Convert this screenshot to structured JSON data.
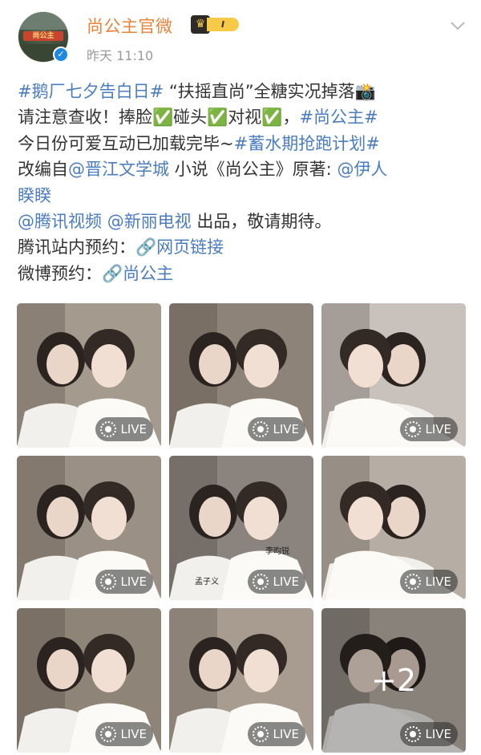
{
  "post": {
    "username": "尚公主官微",
    "timestamp": "昨天 11:10",
    "verified_icon": "verified-badge-icon",
    "level_badge": "I",
    "avatar_text": "尚公主",
    "lines": [
      [
        {
          "t": "#鹅厂七夕告白日#",
          "c": "blue"
        },
        {
          "t": " “扶摇直尚”全糖实况掉落📸",
          "c": ""
        }
      ],
      [
        {
          "t": "请注意查收！捧脸✅碰头✅对视✅，",
          "c": ""
        },
        {
          "t": "#尚公主#",
          "c": "blue"
        }
      ],
      [
        {
          "t": "今日份可爱互动已加载完毕~",
          "c": ""
        },
        {
          "t": "#蓄水期抢跑计划#",
          "c": "blue"
        }
      ],
      [
        {
          "t": "改编自",
          "c": ""
        },
        {
          "t": "@晋江文学城",
          "c": "blue"
        },
        {
          "t": " 小说《尚公主》原著: ",
          "c": ""
        },
        {
          "t": "@伊人",
          "c": "blue"
        }
      ],
      [
        {
          "t": "睽睽",
          "c": "blue"
        }
      ],
      [
        {
          "t": "@腾讯视频",
          "c": "blue"
        },
        {
          "t": " ",
          "c": ""
        },
        {
          "t": "@新丽电视",
          "c": "blue"
        },
        {
          "t": " 出品，敬请期待。",
          "c": ""
        }
      ],
      [
        {
          "t": "腾讯站内预约：",
          "c": ""
        },
        {
          "t": "🔗网页链接",
          "c": "blue"
        }
      ],
      [
        {
          "t": "微博预约：",
          "c": ""
        },
        {
          "t": "🔗尚公主",
          "c": "blue"
        }
      ]
    ]
  },
  "photos": {
    "live_label": "LIVE",
    "more_count": "+2",
    "shirt_labels": [
      "孟子义",
      "李昀锐"
    ],
    "items": [
      {
        "bg": "#a59a8e",
        "name": "photo-1"
      },
      {
        "bg": "#8e8378",
        "name": "photo-2"
      },
      {
        "bg": "#c9c2bc",
        "name": "photo-3"
      },
      {
        "bg": "#9b9086",
        "name": "photo-4"
      },
      {
        "bg": "#8a837e",
        "name": "photo-5"
      },
      {
        "bg": "#b6ada4",
        "name": "photo-6"
      },
      {
        "bg": "#8f8478",
        "name": "photo-7"
      },
      {
        "bg": "#a89c90",
        "name": "photo-8"
      },
      {
        "bg": "#bdb4ab",
        "name": "photo-9"
      }
    ]
  },
  "colors": {
    "link": "#4a7cc2",
    "username": "#e8833a",
    "text": "#333333",
    "meta": "#9a9a9a"
  }
}
